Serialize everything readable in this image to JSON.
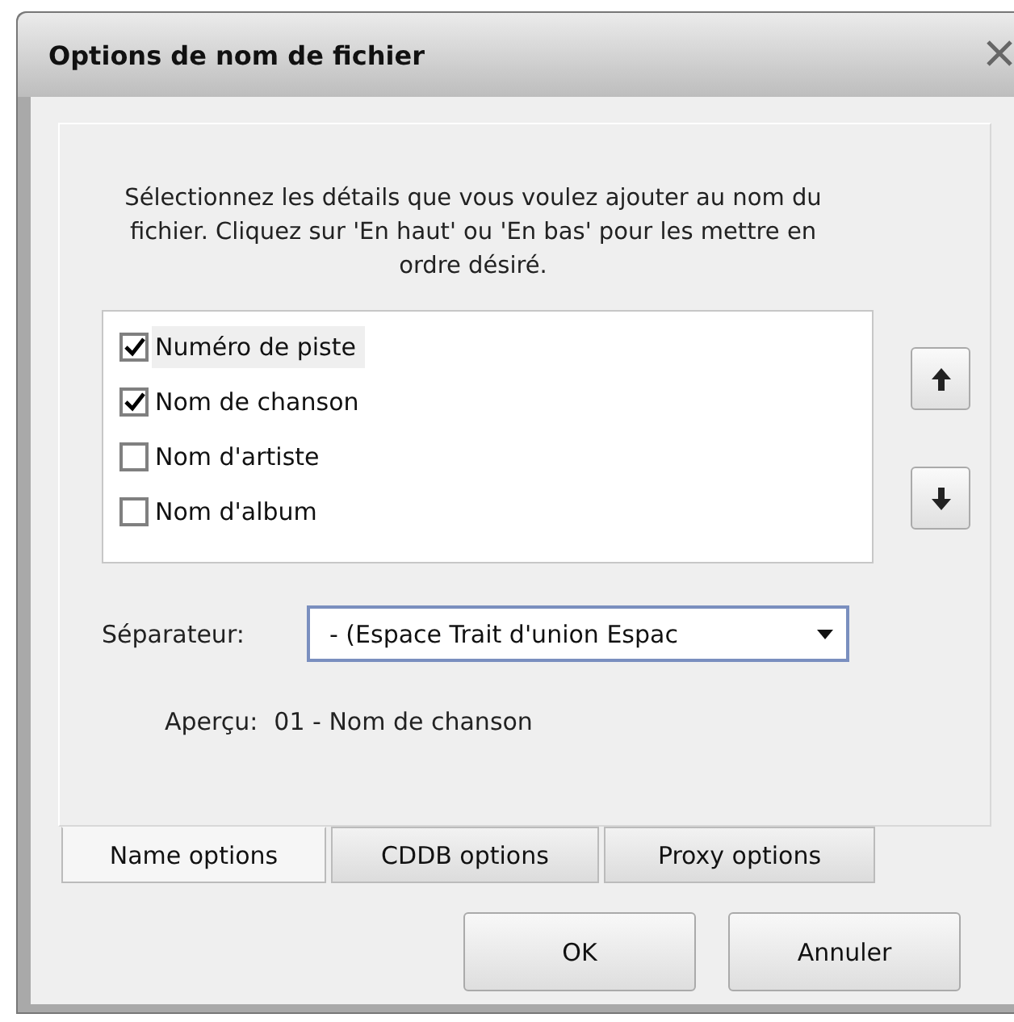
{
  "window": {
    "title": "Options de nom de fichier"
  },
  "instructions": "Sélectionnez les détails que vous voulez ajouter au nom du fichier. Cliquez sur 'En haut' ou 'En bas' pour les mettre en ordre désiré.",
  "fields": [
    {
      "label": "Numéro de piste",
      "checked": true,
      "selected": true
    },
    {
      "label": "Nom de chanson",
      "checked": true,
      "selected": false
    },
    {
      "label": "Nom d'artiste",
      "checked": false,
      "selected": false
    },
    {
      "label": "Nom d'album",
      "checked": false,
      "selected": false
    }
  ],
  "separator": {
    "label": "Séparateur:",
    "value": "- (Espace Trait d'union Espac"
  },
  "preview": {
    "label": "Aperçu:",
    "value": "01 - Nom de chanson"
  },
  "tabs": [
    {
      "label": "Name options",
      "selected": true
    },
    {
      "label": "CDDB options",
      "selected": false
    },
    {
      "label": "Proxy options",
      "selected": false
    }
  ],
  "buttons": [
    "OK",
    "Annuler"
  ]
}
